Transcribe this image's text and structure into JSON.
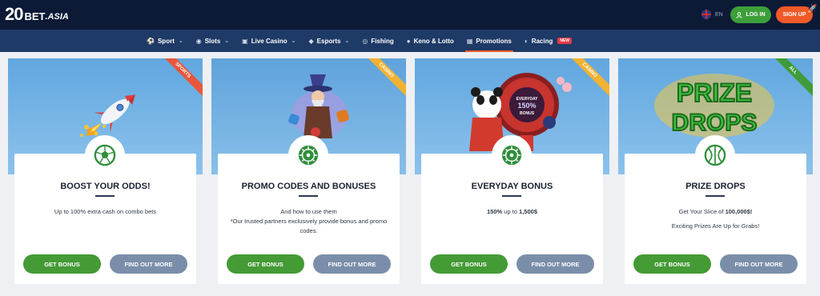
{
  "header": {
    "logo_num": "20",
    "logo_bet": "BET",
    "logo_asia": ".ASIA",
    "lang": "EN",
    "login": "LOG IN",
    "signup": "SIGN UP"
  },
  "nav": {
    "items": [
      {
        "label": "Sport",
        "icon": "sport-icon",
        "chevron": true
      },
      {
        "label": "Slots",
        "icon": "slots-icon",
        "chevron": true
      },
      {
        "label": "Live Casino",
        "icon": "live-casino-icon",
        "chevron": true
      },
      {
        "label": "Esports",
        "icon": "esports-icon",
        "chevron": true
      },
      {
        "label": "Fishing",
        "icon": "fishing-icon",
        "chevron": false
      },
      {
        "label": "Keno & Lotto",
        "icon": "keno-icon",
        "chevron": false
      },
      {
        "label": "Promotions",
        "icon": "gift-icon",
        "chevron": false,
        "active": true
      },
      {
        "label": "Racing",
        "icon": "racing-icon",
        "chevron": false,
        "badge": "NEW"
      }
    ]
  },
  "cards": [
    {
      "ribbon": "SPORTS",
      "ribbon_color": "#e8563a",
      "title": "BOOST YOUR ODDS!",
      "desc1": "Up to 100% extra cash on combo bets",
      "desc2": "",
      "desc3": "",
      "get": "GET BONUS",
      "more": "FIND OUT MORE"
    },
    {
      "ribbon": "CASINO",
      "ribbon_color": "#f2b233",
      "title": "PROMO CODES AND BONUSES",
      "desc1": "And how to use them",
      "desc2": "*Our trusted partners exclusively provide bonus and promo codes.",
      "desc3": "",
      "get": "GET BONUS",
      "more": "FIND OUT MORE"
    },
    {
      "ribbon": "CASINO",
      "ribbon_color": "#f2b233",
      "title": "EVERYDAY BONUS",
      "desc1_bold": "150%",
      "desc1_mid": " up to ",
      "desc1_bold2": "1,500$",
      "get": "GET BONUS",
      "more": "FIND OUT MORE",
      "wheel_text": "EVERYDAY 150% BONUS"
    },
    {
      "ribbon": "ALL",
      "ribbon_color": "#3f9c3a",
      "title": "PRIZE DROPS",
      "desc1_pre": "Get Your Slice of ",
      "desc1_bold": "100,000$!",
      "desc2": "Exciting Prizes Are Up for Grabs!",
      "get": "GET BONUS",
      "more": "FIND OUT MORE",
      "art_line1": "PRIZE",
      "art_line2": "DROPS"
    }
  ]
}
